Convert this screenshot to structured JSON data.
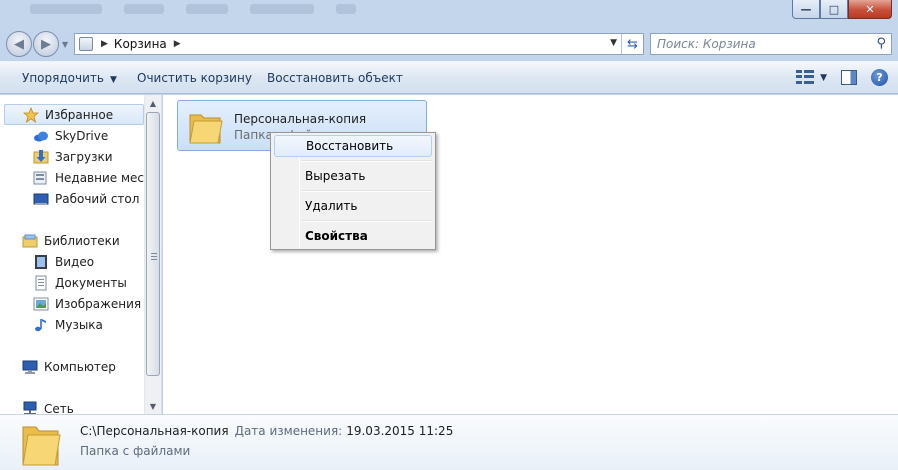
{
  "window": {
    "caption_minimize": "—",
    "caption_maximize": "□",
    "caption_close": "✕"
  },
  "address": {
    "crumb": "Корзина",
    "search_placeholder": "Поиск: Корзина"
  },
  "toolbar": {
    "organize_label": "Упорядочить",
    "empty_label": "Очистить корзину",
    "restore_label": "Восстановить объект"
  },
  "sidebar": {
    "items": [
      {
        "label": "Избранное",
        "icon": "star-icon"
      },
      {
        "label": "SkyDrive",
        "icon": "cloud-icon"
      },
      {
        "label": "Загрузки",
        "icon": "downloads-icon"
      },
      {
        "label": "Недавние места",
        "icon": "recent-places-icon"
      },
      {
        "label": "Рабочий стол",
        "icon": "desktop-icon"
      },
      {
        "label": "Библиотеки",
        "icon": "libraries-icon"
      },
      {
        "label": "Видео",
        "icon": "video-icon"
      },
      {
        "label": "Документы",
        "icon": "documents-icon"
      },
      {
        "label": "Изображения",
        "icon": "pictures-icon"
      },
      {
        "label": "Музыка",
        "icon": "music-icon"
      },
      {
        "label": "Компьютер",
        "icon": "computer-icon"
      },
      {
        "label": "Сеть",
        "icon": "network-icon"
      }
    ]
  },
  "content": {
    "item_name": "Персональная-копия",
    "item_type": "Папка с файлами"
  },
  "context_menu": {
    "items": [
      "Восстановить",
      "Вырезать",
      "Удалить",
      "Свойства"
    ]
  },
  "details": {
    "path": "C:\\Персональная-копия",
    "modified_label": "Дата изменения:",
    "modified_value": "19.03.2015 11:25",
    "type": "Папка с файлами"
  },
  "colors": {
    "selection": "#cadff7",
    "accent": "#1e395b",
    "close": "#c7503a"
  }
}
